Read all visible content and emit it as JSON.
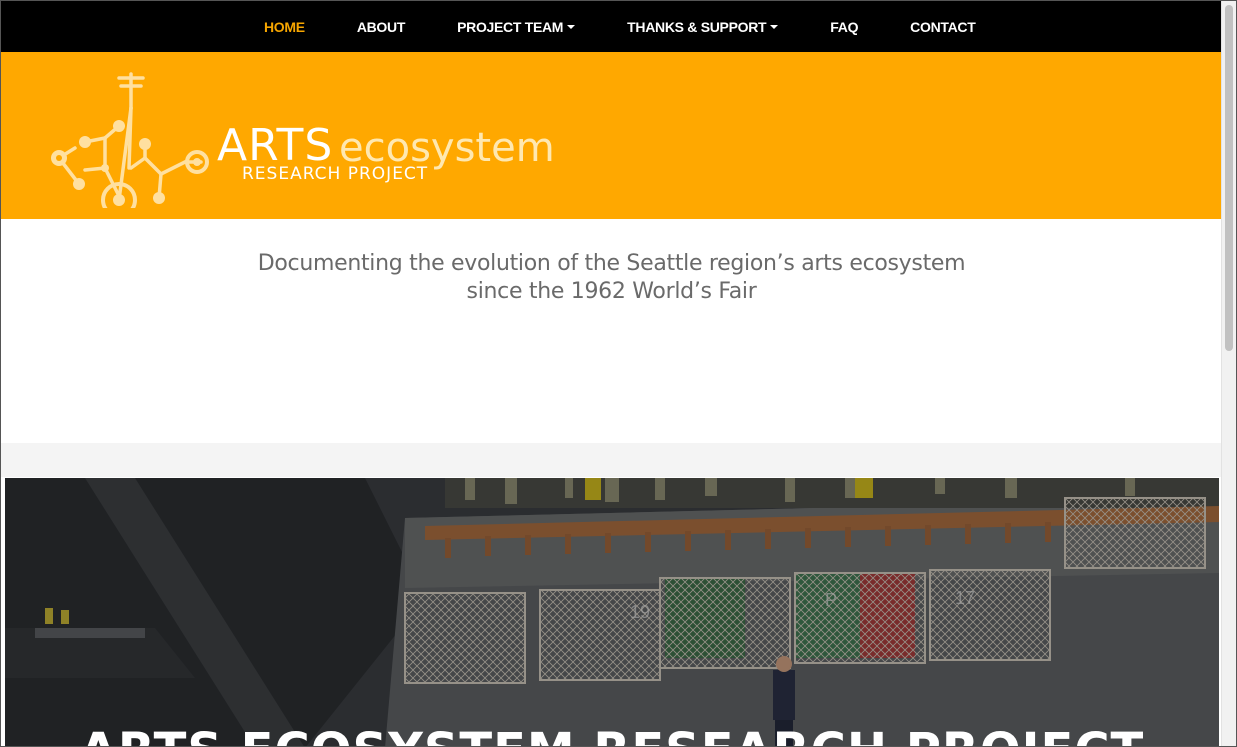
{
  "nav": {
    "items": [
      {
        "label": "HOME",
        "active": true,
        "dropdown": false
      },
      {
        "label": "ABOUT",
        "active": false,
        "dropdown": false
      },
      {
        "label": "PROJECT TEAM",
        "active": false,
        "dropdown": true
      },
      {
        "label": "THANKS & SUPPORT",
        "active": false,
        "dropdown": true
      },
      {
        "label": "FAQ",
        "active": false,
        "dropdown": false
      },
      {
        "label": "CONTACT",
        "active": false,
        "dropdown": false
      }
    ]
  },
  "logo": {
    "word_arts": "ARTS",
    "word_ecosystem": "ecosystem",
    "subtitle": "RESEARCH  PROJECT"
  },
  "tagline": {
    "line1": "Documenting the evolution of the Seattle region’s arts ecosystem",
    "line2": "since the 1962 World’s Fair"
  },
  "hero": {
    "title": "ARTS ECOSYSTEM RESEARCH PROJECT",
    "deck_numbers": [
      "19",
      "P",
      "17"
    ]
  },
  "colors": {
    "accent": "#ffa800",
    "nav_active": "#f7a600",
    "nav_bg": "#000000"
  }
}
